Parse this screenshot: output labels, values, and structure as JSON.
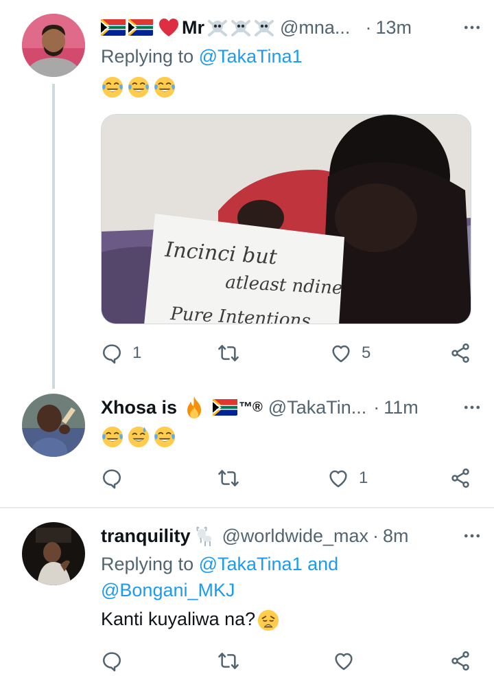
{
  "tweets": [
    {
      "display_name": "Mr",
      "handle": "@mna...",
      "time": "13m",
      "reply_prefix": "Replying to",
      "reply_mentions": "@TakaTina1",
      "text": "",
      "emojis": [
        "face-with-tears-of-joy",
        "face-with-tears-of-joy",
        "face-with-tears-of-joy"
      ],
      "media_text": [
        "Incinci but",
        "atleast ndine",
        "Pure   Intentions"
      ],
      "actions": {
        "reply_count": "1",
        "retweet_count": "",
        "like_count": "5"
      }
    },
    {
      "display_name": "Xhosa is",
      "name_suffix": "™®",
      "handle": "@TakaTin...",
      "time": "11m",
      "emojis": [
        "face-with-tears-of-joy",
        "grinning-face-with-sweat",
        "face-with-tears-of-joy"
      ],
      "actions": {
        "reply_count": "",
        "retweet_count": "",
        "like_count": "1"
      }
    },
    {
      "display_name": "tranquility",
      "handle": "@worldwide_max",
      "time": "8m",
      "reply_prefix": "Replying to",
      "reply_mentions_line1": "@TakaTina1 and",
      "reply_mentions_line2": "@Bongani_MKJ",
      "text": "Kanti kuyaliwa na?",
      "actions": {
        "reply_count": "",
        "retweet_count": "",
        "like_count": ""
      }
    }
  ],
  "separator": "·",
  "colors": {
    "accent": "#1d9bf0",
    "secondary_text": "#536471",
    "divider": "#e7ebee",
    "like_heart": "#e0245e"
  },
  "icons": [
    "reply-icon",
    "retweet-icon",
    "like-icon",
    "share-icon",
    "more-icon",
    "flag-icon",
    "heart-icon",
    "skull-crossbones-icon",
    "fire-icon",
    "goat-icon"
  ]
}
